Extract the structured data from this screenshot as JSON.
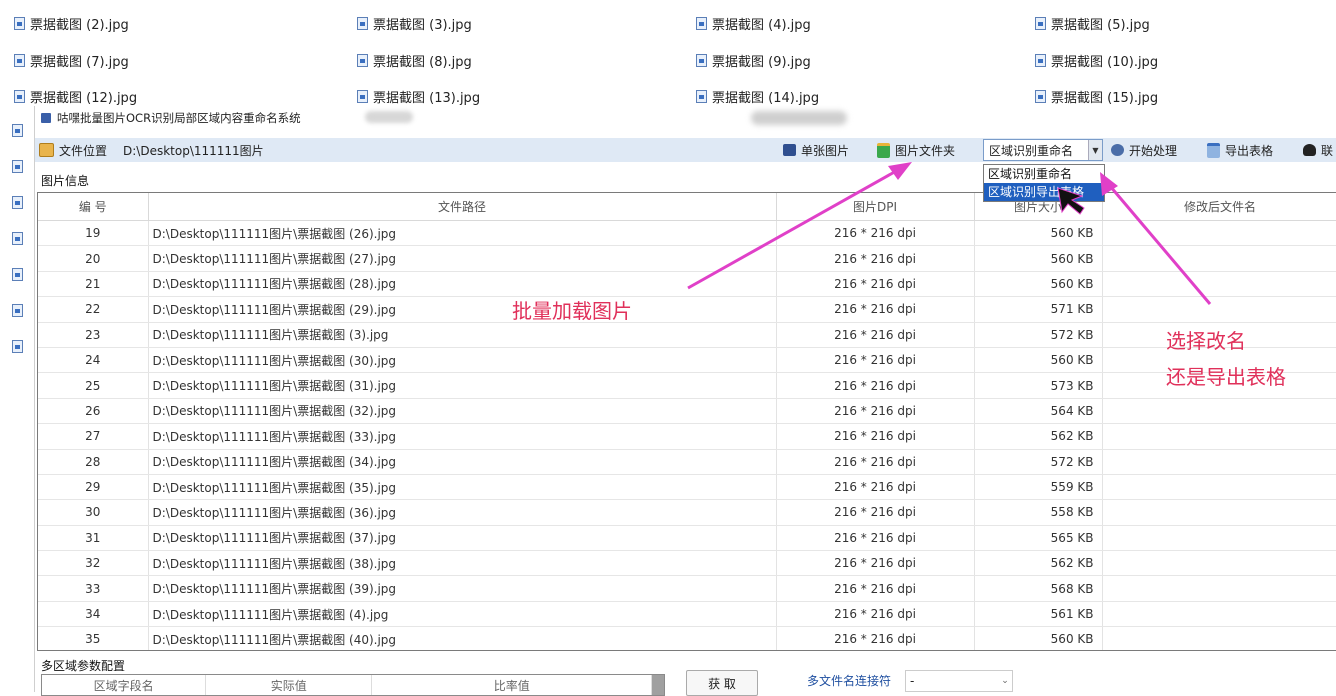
{
  "background_files": [
    {
      "name": "票据截图 (2).jpg"
    },
    {
      "name": "票据截图 (3).jpg"
    },
    {
      "name": "票据截图 (4).jpg"
    },
    {
      "name": "票据截图 (5).jpg"
    },
    {
      "name": "票据截图 (7).jpg"
    },
    {
      "name": "票据截图 (8).jpg"
    },
    {
      "name": "票据截图 (9).jpg"
    },
    {
      "name": "票据截图 (10).jpg"
    },
    {
      "name": "票据截图 (12).jpg"
    },
    {
      "name": "票据截图 (13).jpg"
    },
    {
      "name": "票据截图 (14).jpg"
    },
    {
      "name": "票据截图 (15).jpg"
    }
  ],
  "window": {
    "title": "咕嘿批量图片OCR识别局部区域内容重命名系统"
  },
  "toolbar": {
    "file_location_label": "文件位置",
    "path": "D:\\Desktop\\111111图片",
    "single_image_label": "单张图片",
    "image_folder_label": "图片文件夹",
    "mode_selected": "区域识别重命名",
    "start_label": "开始处理",
    "export_label": "导出表格",
    "contact_label": "联"
  },
  "mode_dropdown": {
    "options": [
      "区域识别重命名",
      "区域识别导出表格"
    ]
  },
  "image_info": {
    "group_label": "图片信息",
    "columns": [
      "编 号",
      "文件路径",
      "图片DPI",
      "图片大小",
      "修改后文件名"
    ],
    "rows": [
      {
        "num": "19",
        "path": "D:\\Desktop\\111111图片\\票据截图 (26).jpg",
        "dpi": "216 * 216 dpi",
        "size": "560 KB",
        "new_name": ""
      },
      {
        "num": "20",
        "path": "D:\\Desktop\\111111图片\\票据截图 (27).jpg",
        "dpi": "216 * 216 dpi",
        "size": "560 KB",
        "new_name": ""
      },
      {
        "num": "21",
        "path": "D:\\Desktop\\111111图片\\票据截图 (28).jpg",
        "dpi": "216 * 216 dpi",
        "size": "560 KB",
        "new_name": ""
      },
      {
        "num": "22",
        "path": "D:\\Desktop\\111111图片\\票据截图 (29).jpg",
        "dpi": "216 * 216 dpi",
        "size": "571 KB",
        "new_name": ""
      },
      {
        "num": "23",
        "path": "D:\\Desktop\\111111图片\\票据截图 (3).jpg",
        "dpi": "216 * 216 dpi",
        "size": "572 KB",
        "new_name": ""
      },
      {
        "num": "24",
        "path": "D:\\Desktop\\111111图片\\票据截图 (30).jpg",
        "dpi": "216 * 216 dpi",
        "size": "560 KB",
        "new_name": ""
      },
      {
        "num": "25",
        "path": "D:\\Desktop\\111111图片\\票据截图 (31).jpg",
        "dpi": "216 * 216 dpi",
        "size": "573 KB",
        "new_name": ""
      },
      {
        "num": "26",
        "path": "D:\\Desktop\\111111图片\\票据截图 (32).jpg",
        "dpi": "216 * 216 dpi",
        "size": "564 KB",
        "new_name": ""
      },
      {
        "num": "27",
        "path": "D:\\Desktop\\111111图片\\票据截图 (33).jpg",
        "dpi": "216 * 216 dpi",
        "size": "562 KB",
        "new_name": ""
      },
      {
        "num": "28",
        "path": "D:\\Desktop\\111111图片\\票据截图 (34).jpg",
        "dpi": "216 * 216 dpi",
        "size": "572 KB",
        "new_name": ""
      },
      {
        "num": "29",
        "path": "D:\\Desktop\\111111图片\\票据截图 (35).jpg",
        "dpi": "216 * 216 dpi",
        "size": "559 KB",
        "new_name": ""
      },
      {
        "num": "30",
        "path": "D:\\Desktop\\111111图片\\票据截图 (36).jpg",
        "dpi": "216 * 216 dpi",
        "size": "558 KB",
        "new_name": ""
      },
      {
        "num": "31",
        "path": "D:\\Desktop\\111111图片\\票据截图 (37).jpg",
        "dpi": "216 * 216 dpi",
        "size": "565 KB",
        "new_name": ""
      },
      {
        "num": "32",
        "path": "D:\\Desktop\\111111图片\\票据截图 (38).jpg",
        "dpi": "216 * 216 dpi",
        "size": "562 KB",
        "new_name": ""
      },
      {
        "num": "33",
        "path": "D:\\Desktop\\111111图片\\票据截图 (39).jpg",
        "dpi": "216 * 216 dpi",
        "size": "568 KB",
        "new_name": ""
      },
      {
        "num": "34",
        "path": "D:\\Desktop\\111111图片\\票据截图 (4).jpg",
        "dpi": "216 * 216 dpi",
        "size": "561 KB",
        "new_name": ""
      },
      {
        "num": "35",
        "path": "D:\\Desktop\\111111图片\\票据截图 (40).jpg",
        "dpi": "216 * 216 dpi",
        "size": "560 KB",
        "new_name": ""
      }
    ]
  },
  "multi_region": {
    "group_label": "多区域参数配置",
    "columns": [
      "区域字段名",
      "实际值",
      "比率值"
    ],
    "fetch_label": "获 取",
    "separator_label": "多文件名连接符",
    "separator_value": "-"
  },
  "annotations": {
    "batch_load": "批量加载图片",
    "choose_line1": "选择改名",
    "choose_line2": "还是导出表格",
    "color": "#e0305a"
  }
}
